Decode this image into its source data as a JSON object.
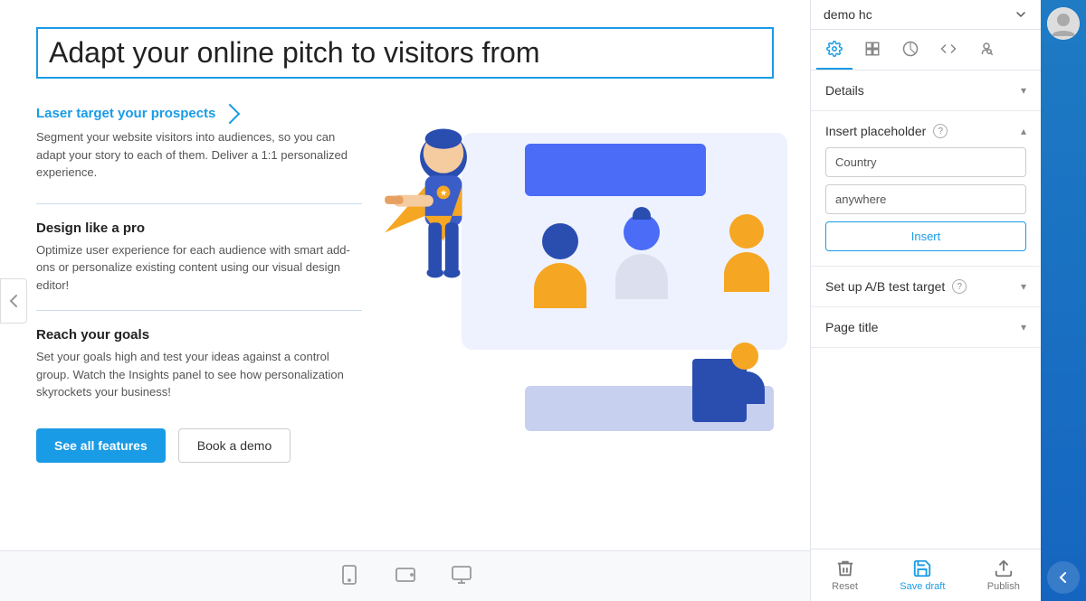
{
  "site": {
    "name": "demo hc"
  },
  "header": {
    "title": "Adapt your online pitch to visitors from"
  },
  "sections": [
    {
      "id": "laser",
      "link": "Laser target your prospects",
      "text": "Segment your website visitors into audiences, so you can adapt your story to each of them. Deliver a 1:1 personalized experience."
    },
    {
      "id": "design",
      "heading": "Design like a pro",
      "text": "Optimize user experience for each audience with smart add-ons or personalize existing content using our visual design editor!"
    },
    {
      "id": "goals",
      "heading": "Reach your goals",
      "text": "Set your goals high and test your ideas against a control group. Watch the Insights panel to see how personalization skyrockets your business!"
    }
  ],
  "buttons": {
    "see_all": "See all features",
    "book_demo": "Book a demo"
  },
  "tabs": [
    {
      "id": "settings",
      "icon": "⚙",
      "label": "Settings",
      "active": true
    },
    {
      "id": "blocks",
      "icon": "◫",
      "label": "Blocks",
      "active": false
    },
    {
      "id": "paint",
      "icon": "🎨",
      "label": "Design",
      "active": false
    },
    {
      "id": "code",
      "icon": "<>",
      "label": "Code",
      "active": false
    },
    {
      "id": "seo",
      "icon": "🐛",
      "label": "SEO",
      "active": false
    }
  ],
  "panel": {
    "details_label": "Details",
    "insert_placeholder_label": "Insert placeholder",
    "country_field": "Country",
    "anywhere_field": "anywhere",
    "insert_button": "Insert",
    "ab_test_label": "Set up A/B test target",
    "page_title_label": "Page title"
  },
  "footer": {
    "reset_label": "Reset",
    "save_draft_label": "Save draft",
    "publish_label": "Publish"
  },
  "colors": {
    "accent": "#1a9be6",
    "blue_dark": "#1565c0",
    "blue_sidebar": "#1e7bc4"
  }
}
